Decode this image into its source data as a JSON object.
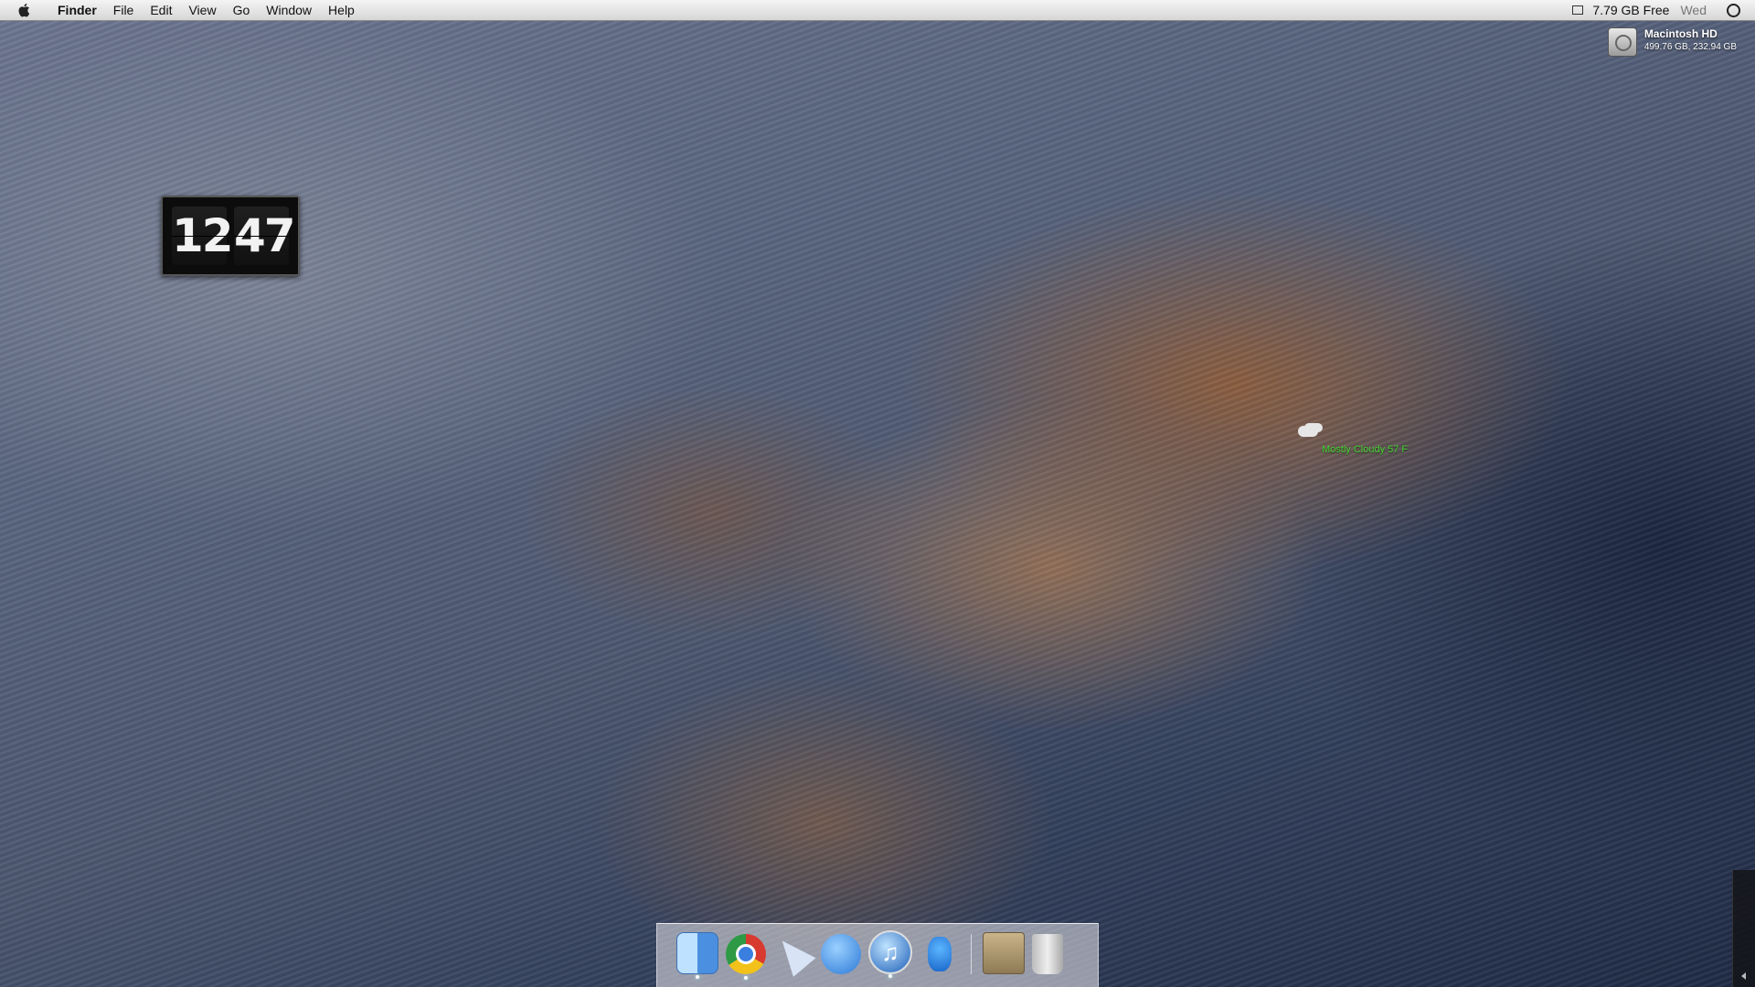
{
  "menubar": {
    "app_name": "Finder",
    "items": [
      "File",
      "Edit",
      "View",
      "Go",
      "Window",
      "Help"
    ],
    "free_space": "7.79 GB Free",
    "day": "Wed"
  },
  "disk": {
    "name": "Macintosh HD",
    "detail": "499.76 GB, 232.94 GB"
  },
  "clock": {
    "hours": "12",
    "minutes": "47"
  },
  "weather": {
    "text": "Mostly Cloudy 57 F"
  },
  "dock": {
    "items": [
      "finder-icon",
      "chrome-icon",
      "cursor-icon",
      "facetime-icon",
      "itunes-icon",
      "twitter-icon",
      "applications-folder-icon",
      "trash-icon"
    ]
  }
}
